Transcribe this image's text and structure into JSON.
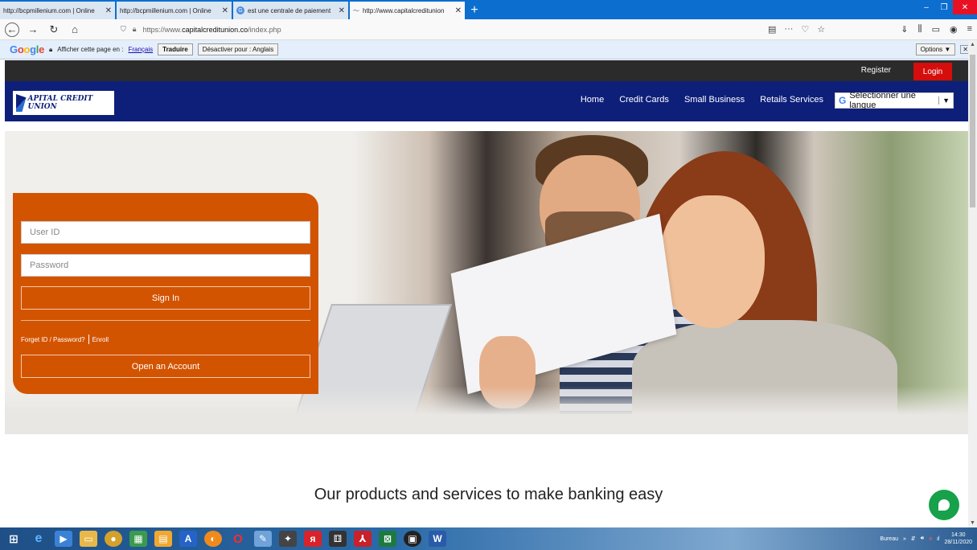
{
  "browser": {
    "tabs": [
      {
        "title": "http://bcpmillenium.com | Online",
        "active": false
      },
      {
        "title": "http://bcpmillenium.com | Online",
        "active": false
      },
      {
        "title": "est une centrale de paiement",
        "active": false
      },
      {
        "title": "http://www.capitalcreditunion",
        "active": true
      }
    ],
    "url_prefix": "https://www.",
    "url_domain": "capitalcreditunion.co",
    "url_path": "/index.php"
  },
  "translate_bar": {
    "logo": "Google",
    "prompt": "Afficher cette page en :",
    "language": "Français",
    "translate_button": "Traduire",
    "disable_button": "Désactiver pour : Anglais",
    "options_button": "Options ▼"
  },
  "site": {
    "register": "Register",
    "login": "Login",
    "logo_text": "APITAL CREDIT UNION",
    "menu": [
      "Home",
      "Credit Cards",
      "Small Business",
      "Retails Services"
    ],
    "language_select": "Sélectionner une langue"
  },
  "login_panel": {
    "user_id_placeholder": "User ID",
    "password_placeholder": "Password",
    "sign_in": "Sign In",
    "forget": "Forget ID / Password?",
    "enroll": "Enroll",
    "open_account": "Open an Account"
  },
  "products_heading": "Our products and services to make banking easy",
  "taskbar": {
    "tray_label": "Bureau",
    "time": "14:30",
    "date": "28/11/2020"
  },
  "colors": {
    "header_blue": "#0e1f7a",
    "login_orange": "#d35400",
    "login_red": "#d50d0d",
    "chat_green": "#17a14b"
  }
}
